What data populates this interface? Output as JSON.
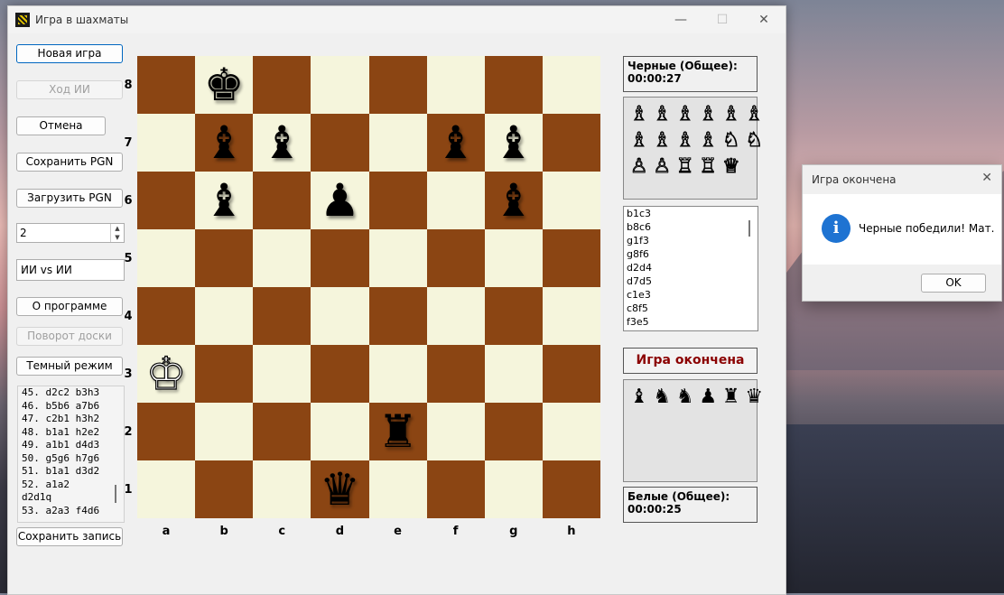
{
  "window": {
    "title": "Игра в шахматы",
    "controls": {
      "minimize": "—",
      "maximize": "☐",
      "close": "✕"
    }
  },
  "buttons": {
    "new_game": "Новая игра",
    "ai_move": "Ход ИИ",
    "undo": "Отмена",
    "save_pgn": "Сохранить PGN",
    "load_pgn": "Загрузить PGN",
    "about": "О программе",
    "flip_board": "Поворот доски",
    "dark_mode": "Темный режим",
    "save_record": "Сохранить запись"
  },
  "depth_spinner": {
    "value": "2"
  },
  "mode_select": {
    "value": "ИИ vs ИИ"
  },
  "move_log": [
    "45. d2c2 b3h3",
    "46. b5b6 a7b6",
    "47. c2b1 h3h2",
    "48. b1a1 h2e2",
    "49. a1b1 d4d3",
    "50. g5g6 h7g6",
    "51. b1a1 d3d2",
    "52. a1a2",
    "d2d1q",
    "53. a2a3 f4d6"
  ],
  "board": {
    "ranks": [
      "8",
      "7",
      "6",
      "5",
      "4",
      "3",
      "2",
      "1"
    ],
    "files": [
      "a",
      "b",
      "c",
      "d",
      "e",
      "f",
      "g",
      "h"
    ],
    "light_color": "#f5f5dc",
    "dark_color": "#8b4513",
    "pieces": [
      {
        "square": "b8",
        "glyph": "♚",
        "color": "black",
        "name": "black-king"
      },
      {
        "square": "b7",
        "glyph": "♝",
        "color": "black",
        "name": "black-bishop"
      },
      {
        "square": "c7",
        "glyph": "♝",
        "color": "black",
        "name": "black-bishop"
      },
      {
        "square": "f7",
        "glyph": "♝",
        "color": "black",
        "name": "black-bishop"
      },
      {
        "square": "g7",
        "glyph": "♝",
        "color": "black",
        "name": "black-bishop"
      },
      {
        "square": "b6",
        "glyph": "♝",
        "color": "black",
        "name": "black-bishop"
      },
      {
        "square": "d6",
        "glyph": "♟",
        "color": "black",
        "name": "black-pawn"
      },
      {
        "square": "g6",
        "glyph": "♝",
        "color": "black",
        "name": "black-bishop"
      },
      {
        "square": "a3",
        "glyph": "♔",
        "color": "white",
        "name": "white-king"
      },
      {
        "square": "e2",
        "glyph": "♜",
        "color": "black",
        "name": "black-rook"
      },
      {
        "square": "d1",
        "glyph": "♛",
        "color": "black",
        "name": "black-queen"
      }
    ]
  },
  "black_clock": {
    "label": "Черные (Общее):",
    "time": "00:00:27"
  },
  "white_clock": {
    "label": "Белые (Общее):",
    "time": "00:00:25"
  },
  "captured_white": [
    "♗",
    "♗",
    "♗",
    "♗",
    "♗",
    "♗",
    "♗",
    "♗",
    "♗",
    "♗",
    "♘",
    "♘",
    "♙",
    "♙",
    "♖",
    "♖",
    "♕"
  ],
  "captured_black": [
    "♝",
    "♞",
    "♞",
    "♟",
    "♜",
    "♛"
  ],
  "history": [
    "b1c3",
    "b8c6",
    "g1f3",
    "g8f6",
    "d2d4",
    "d7d5",
    "c1e3",
    "c8f5",
    "f3e5"
  ],
  "status": "Игра окончена",
  "dialog": {
    "title": "Игра окончена",
    "message": "Черные победили! Мат.",
    "ok": "OK",
    "close": "✕",
    "icon": "i"
  }
}
